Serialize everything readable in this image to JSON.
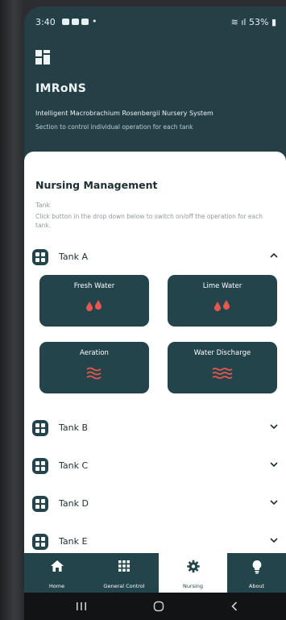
{
  "status_bar": {
    "time": "3:40",
    "battery": "53%"
  },
  "app": {
    "title": "IMRoNS",
    "subtitle": "Intelligent Macrobrachium Rosenbergii Nursery System",
    "description": "Section to control individual operation for each tank"
  },
  "section": {
    "title": "Nursing Management",
    "field_label": "Tank",
    "helper_text": "Click button in the drop down below to switch on/off the operation for each tank."
  },
  "tanks": [
    {
      "name": "Tank A",
      "expanded": true
    },
    {
      "name": "Tank B",
      "expanded": false
    },
    {
      "name": "Tank C",
      "expanded": false
    },
    {
      "name": "Tank D",
      "expanded": false
    },
    {
      "name": "Tank E",
      "expanded": false
    }
  ],
  "controls": [
    {
      "label": "Fresh Water",
      "icon": "water-drops-icon"
    },
    {
      "label": "Lime Water",
      "icon": "water-drops-icon"
    },
    {
      "label": "Aeration",
      "icon": "air-waves-icon"
    },
    {
      "label": "Water Discharge",
      "icon": "water-waves-icon"
    }
  ],
  "bottom_nav": [
    {
      "label": "Home",
      "icon": "home-icon",
      "active": false
    },
    {
      "label": "General Control",
      "icon": "grid-icon",
      "active": false
    },
    {
      "label": "Nursing",
      "icon": "gear-icon",
      "active": true
    },
    {
      "label": "About",
      "icon": "lightbulb-icon",
      "active": false
    }
  ],
  "colors": {
    "primary": "#23444b",
    "accent": "#e8574d",
    "background": "#ffffff"
  }
}
